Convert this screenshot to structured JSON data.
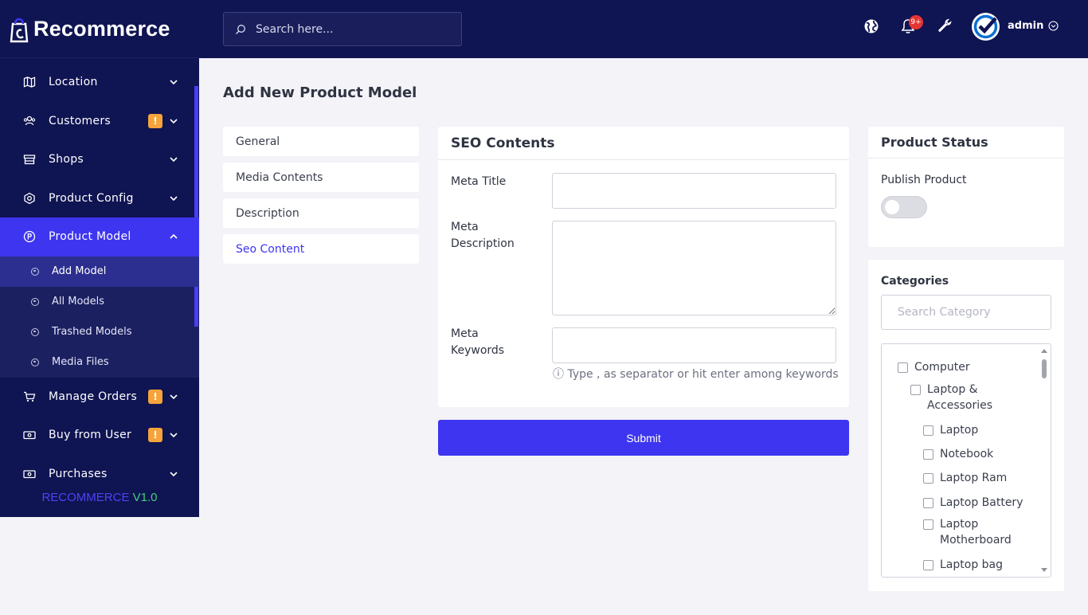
{
  "brand": {
    "name": "Recommerce"
  },
  "header": {
    "search_placeholder": "Search here...",
    "notification_count": "9+",
    "user_name": "admin"
  },
  "sidebar": {
    "items": [
      {
        "label": "Location",
        "icon": "map-icon"
      },
      {
        "label": "Customers",
        "icon": "users-icon",
        "badge": "!"
      },
      {
        "label": "Shops",
        "icon": "shop-icon"
      },
      {
        "label": "Product Config",
        "icon": "config-icon"
      },
      {
        "label": "Product Model",
        "icon": "product-icon",
        "expanded": true
      },
      {
        "label": "Manage Orders",
        "icon": "cart-icon",
        "badge": "!"
      },
      {
        "label": "Buy from User",
        "icon": "cash-icon",
        "badge": "!"
      },
      {
        "label": "Purchases",
        "icon": "cash-icon"
      }
    ],
    "sub_items": [
      {
        "label": "Add Model",
        "active": true
      },
      {
        "label": "All Models"
      },
      {
        "label": "Trashed Models"
      },
      {
        "label": "Media Files"
      }
    ],
    "version_name": "RECOMMERCE",
    "version_number": "V1.0"
  },
  "page": {
    "title": "Add New Product Model",
    "tabs": [
      "General",
      "Media Contents",
      "Description",
      "Seo Content"
    ],
    "active_tab": "Seo Content"
  },
  "seo": {
    "heading": "SEO Contents",
    "meta_title_label": "Meta Title",
    "meta_title_value": "",
    "meta_description_label": "Meta Description",
    "meta_description_value": "",
    "meta_keywords_label": "Meta Keywords",
    "meta_keywords_value": "",
    "keywords_hint": "ⓘ Type , as separator or hit enter among keywords",
    "submit_label": "Submit"
  },
  "status": {
    "heading": "Product Status",
    "publish_label": "Publish Product",
    "published": false
  },
  "categories": {
    "label": "Categories",
    "search_placeholder": "Search Category",
    "items": [
      {
        "label": "Computer",
        "level": 0
      },
      {
        "label": "Laptop & Accessories",
        "level": 1
      },
      {
        "label": "Laptop",
        "level": 2
      },
      {
        "label": "Notebook",
        "level": 2
      },
      {
        "label": "Laptop Ram",
        "level": 2
      },
      {
        "label": "Laptop Battery",
        "level": 2
      },
      {
        "label": "Laptop Motherboard",
        "level": 2
      },
      {
        "label": "Laptop bag",
        "level": 2
      }
    ]
  },
  "colors": {
    "sidebar_bg": "#0f1452",
    "accent": "#3e35f0",
    "badge_orange": "#f5a43b",
    "notification_red": "#e53434",
    "version_green": "#43d079"
  }
}
